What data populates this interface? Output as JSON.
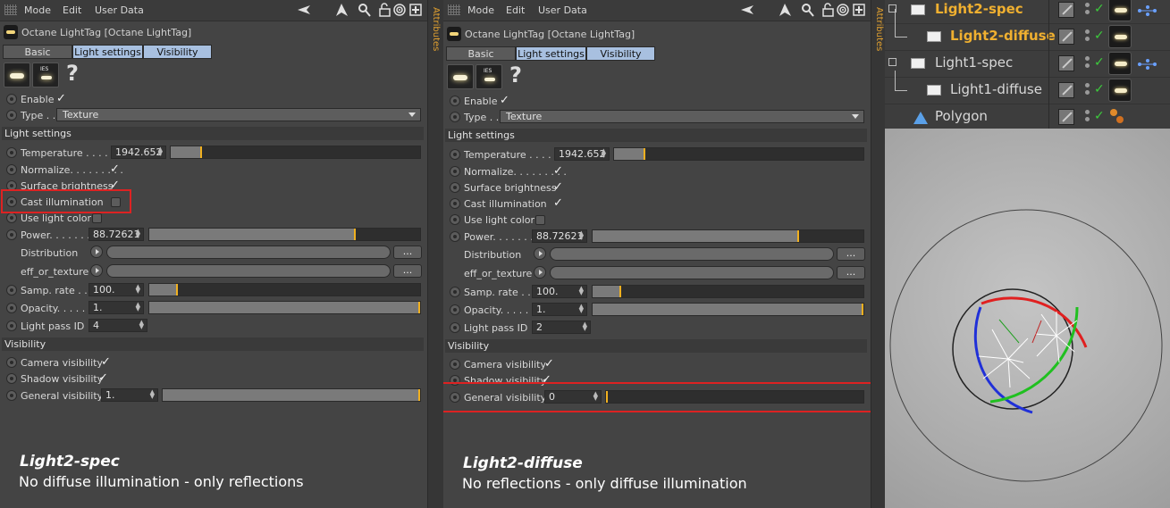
{
  "menus": [
    "Mode",
    "Edit",
    "User Data"
  ],
  "toolbar_icons": [
    "back-arrow-icon",
    "cursor-up-icon",
    "search-icon",
    "lock-icon",
    "target-icon",
    "new-panel-icon"
  ],
  "attributes_tab": "Attributes",
  "panels": [
    {
      "header": "Octane LightTag [Octane LightTag]",
      "tabs": [
        "Basic",
        "Light settings",
        "Visibility"
      ],
      "enable": "Enable",
      "type_label": "Type . .",
      "type_value": "Texture",
      "section_light": "Light settings",
      "temperature_label": "Temperature . . . . .",
      "temperature_value": "1942.652",
      "temperature_level": 0.12,
      "normalize_label": "Normalize. . . . . . . . .",
      "surface_label": "Surface brightness",
      "cast_label": "Cast illumination",
      "cast_checked": false,
      "use_color_label": "Use light color",
      "power_label": "Power. . . . . . . .",
      "power_value": "88.72621",
      "power_level": 0.76,
      "distribution_label": "Distribution",
      "eff_label": "eff_or_texture",
      "dots": "...",
      "samp_label": "Samp. rate . . .",
      "samp_value": "100.",
      "samp_level": 0.1,
      "opacity_label": "Opacity. . . . . .",
      "opacity_value": "1.",
      "opacity_level": 1.0,
      "passid_label": "Light pass ID",
      "passid_value": "4",
      "section_vis": "Visibility",
      "camvis_label": "Camera visibility",
      "shadowvis_label": "Shadow visibility",
      "genvis_label": "General visibility",
      "genvis_value": "1.",
      "genvis_level": 1.0,
      "caption_title": "Light2-spec",
      "caption_text": "No diffuse illumination - only reflections"
    },
    {
      "header": "Octane LightTag [Octane LightTag]",
      "tabs": [
        "Basic",
        "Light settings",
        "Visibility"
      ],
      "enable": "Enable",
      "type_label": "Type . .",
      "type_value": "Texture",
      "section_light": "Light settings",
      "temperature_label": "Temperature . . . . .",
      "temperature_value": "1942.652",
      "temperature_level": 0.12,
      "normalize_label": "Normalize. . . . . . . . .",
      "surface_label": "Surface brightness",
      "cast_label": "Cast illumination",
      "cast_checked": true,
      "use_color_label": "Use light color",
      "power_label": "Power. . . . . . . .",
      "power_value": "88.72621",
      "power_level": 0.76,
      "distribution_label": "Distribution",
      "eff_label": "eff_or_texture",
      "dots": "...",
      "samp_label": "Samp. rate . . .",
      "samp_value": "100.",
      "samp_level": 0.1,
      "opacity_label": "Opacity. . . . . .",
      "opacity_value": "1.",
      "opacity_level": 1.0,
      "passid_label": "Light pass ID",
      "passid_value": "2",
      "section_vis": "Visibility",
      "camvis_label": "Camera visibility",
      "shadowvis_label": "Shadow visibility",
      "genvis_label": "General visibility",
      "genvis_value": "0",
      "genvis_level": 0.0,
      "caption_title": "Light2-diffuse",
      "caption_text": "No reflections - only diffuse illumination"
    }
  ],
  "object_manager": {
    "items": [
      {
        "name": "Light2-spec",
        "color": "#f0b030"
      },
      {
        "name": "Light2-diffuse",
        "color": "#f0b030"
      },
      {
        "name": "Light1-spec",
        "color": "#d8d8d8"
      },
      {
        "name": "Light1-diffuse",
        "color": "#d8d8d8"
      },
      {
        "name": "Polygon",
        "color": "#d8d8d8"
      }
    ]
  }
}
